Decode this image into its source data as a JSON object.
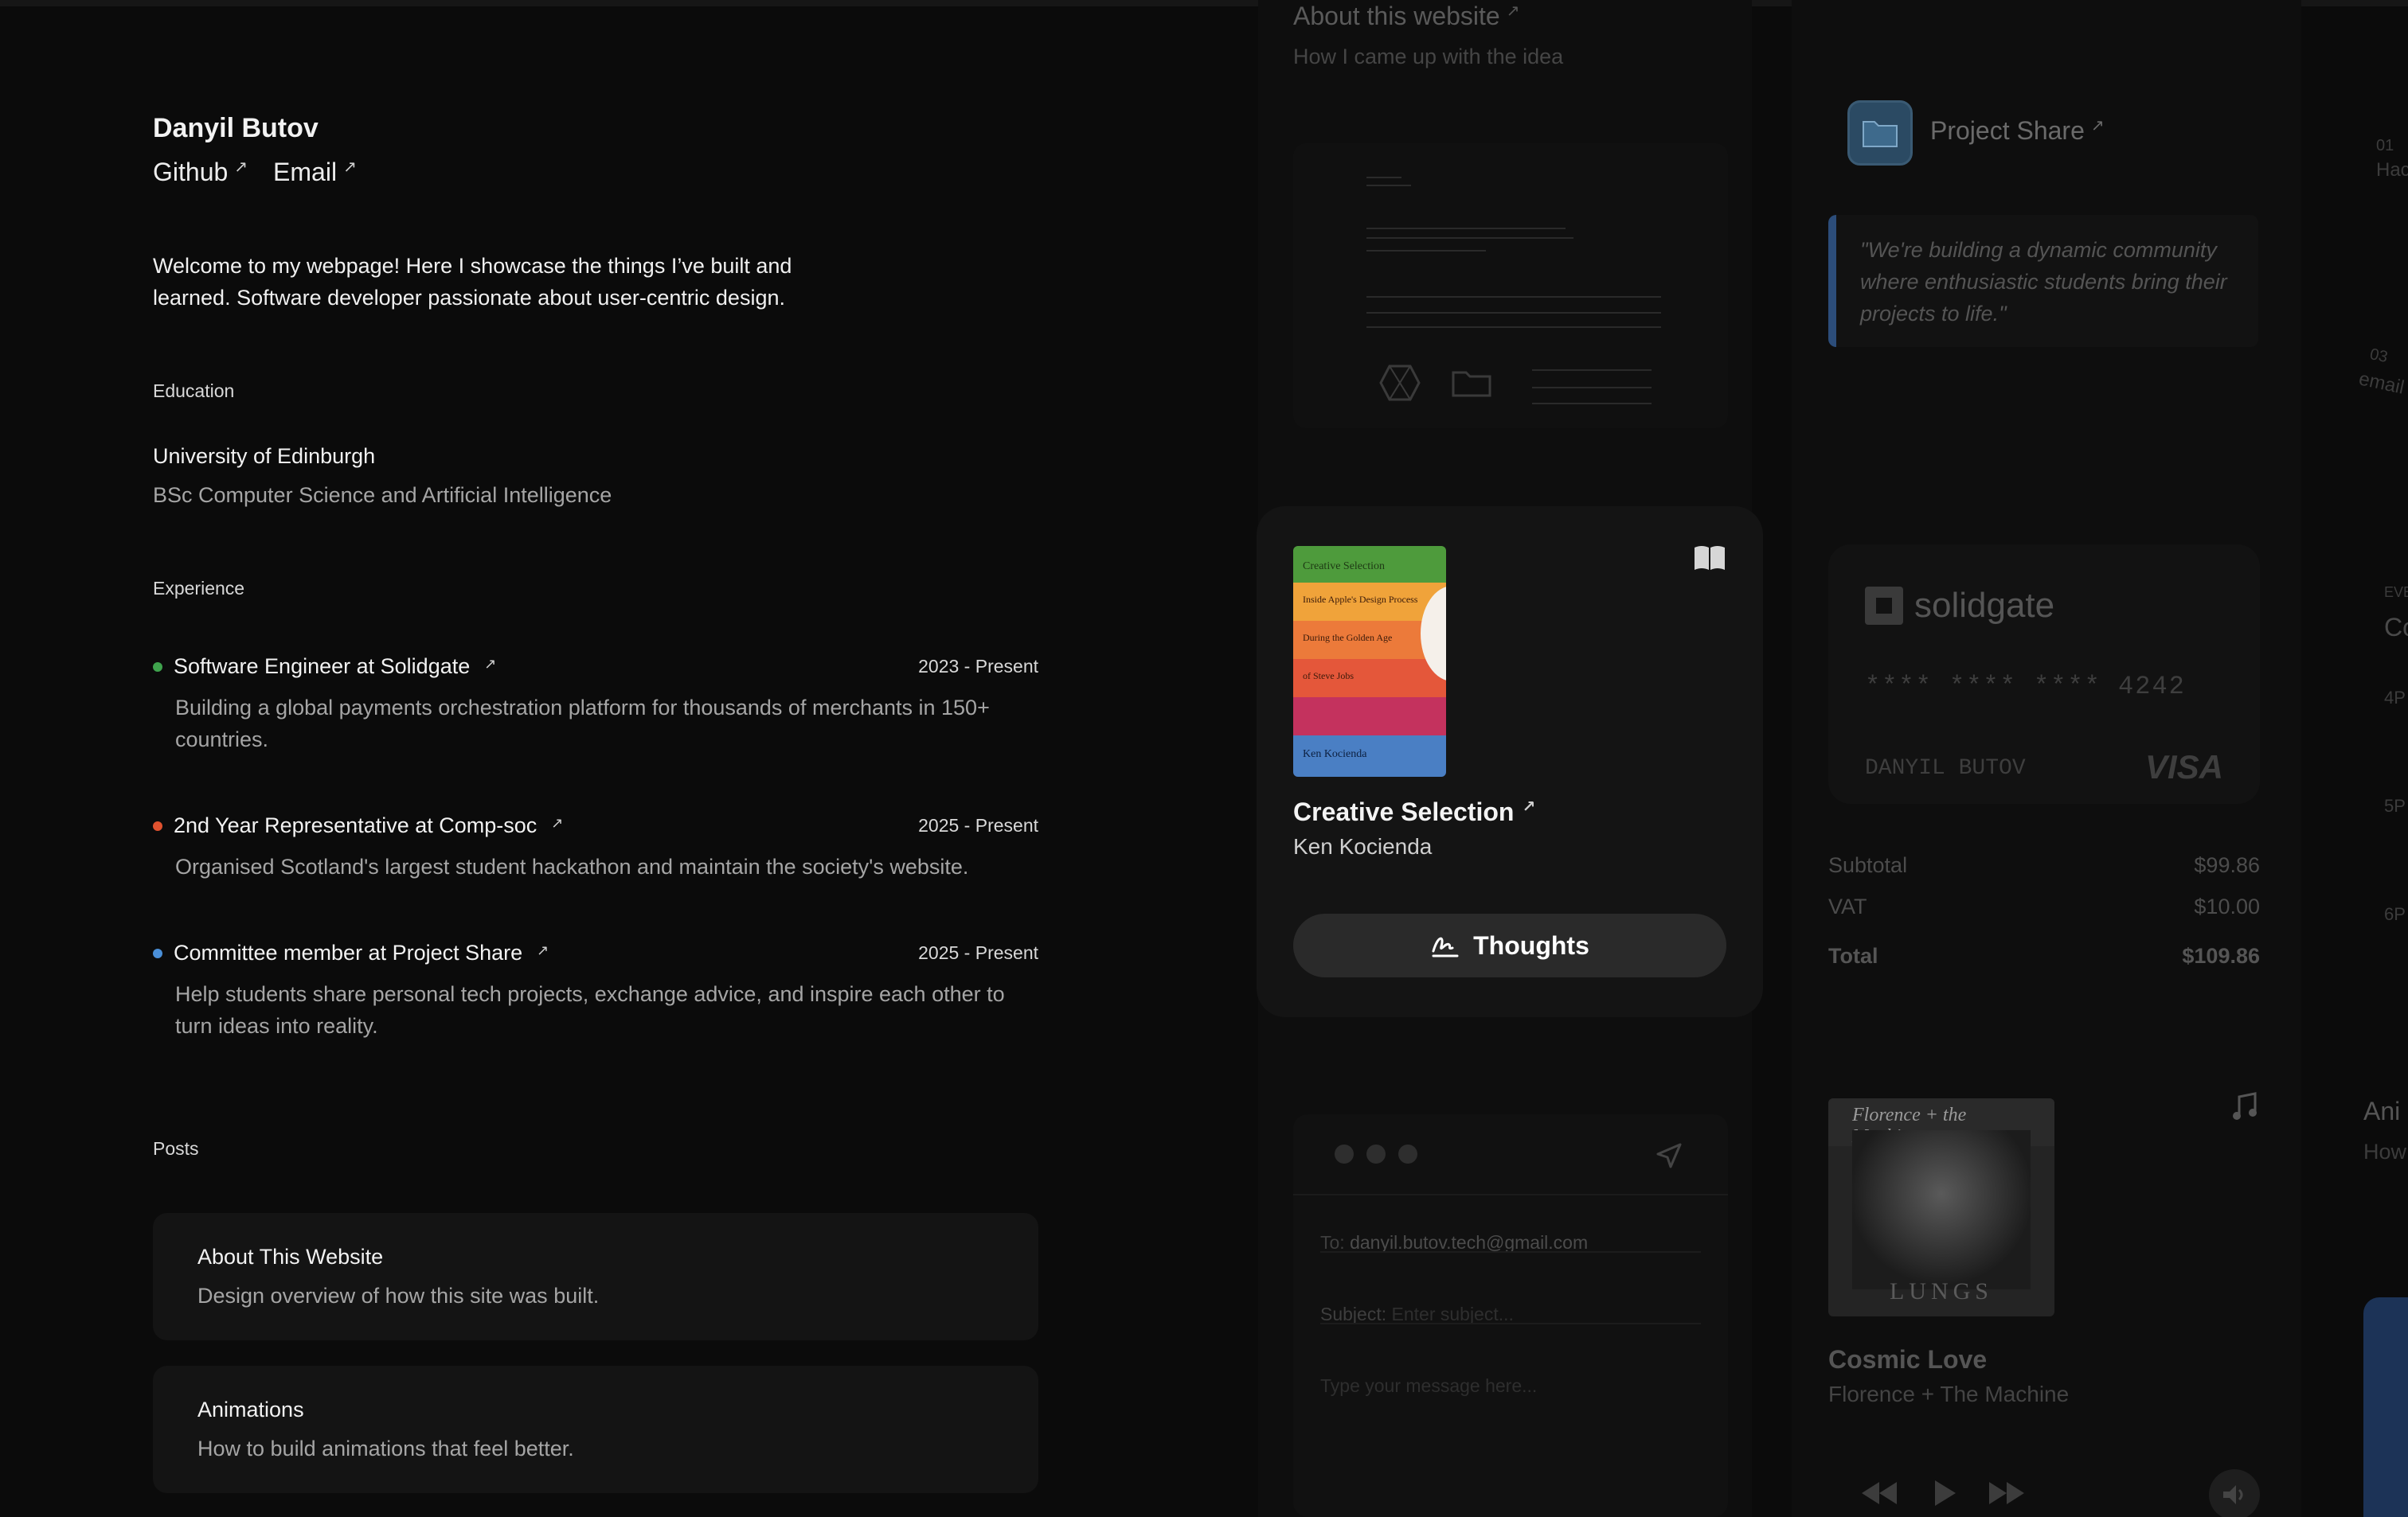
{
  "profile": {
    "name": "Danyil Butov",
    "links": [
      {
        "label": "Github"
      },
      {
        "label": "Email"
      }
    ],
    "intro": "Welcome to my webpage! Here I showcase the things I’ve built and learned. Software developer passionate about user-centric design."
  },
  "education": {
    "label": "Education",
    "school": "University of Edinburgh",
    "degree": "BSc Computer Science and Artificial Intelligence"
  },
  "experience": {
    "label": "Experience",
    "items": [
      {
        "title": "Software Engineer at Solidgate",
        "dates": "2023 - Present",
        "dot_color": "#3fa34d",
        "description": "Building a global payments orchestration platform for thousands of merchants in 150+ countries."
      },
      {
        "title": "2nd Year Representative at Comp-soc",
        "dates": "2025 - Present",
        "dot_color": "#e0522f",
        "description": "Organised Scotland's largest student hackathon and maintain the society's website."
      },
      {
        "title": "Committee member at Project Share",
        "dates": "2025 - Present",
        "dot_color": "#4a8fd8",
        "description": "Help students share personal tech projects, exchange advice, and inspire each other to turn ideas into reality."
      }
    ]
  },
  "posts": {
    "label": "Posts",
    "items": [
      {
        "title": "About This Website",
        "description": "Design overview of how this site was built."
      },
      {
        "title": "Animations",
        "description": "How to build animations that feel better."
      }
    ]
  },
  "showcase": {
    "about": {
      "title": "About this website",
      "subtitle": "How I came up with the idea"
    },
    "project_share": {
      "title": "Project Share",
      "quote": "\"We're building a dynamic community where enthusiastic students bring their projects to life.\""
    },
    "book": {
      "title": "Creative Selection",
      "author": "Ken Kocienda",
      "cover_lines": [
        "Creative Selection",
        "Inside Apple's Design Process",
        "During the Golden Age",
        "of Steve Jobs",
        "Ken Kocienda"
      ],
      "button_label": "Thoughts",
      "icon": "open-book-icon"
    },
    "payment": {
      "brand": "solidgate",
      "card_number": "**** **** **** 4242",
      "card_holder": "DANYIL BUTOV",
      "network": "VISA",
      "lines": [
        {
          "label": "Subtotal",
          "amount": "$99.86"
        },
        {
          "label": "VAT",
          "amount": "$10.00"
        },
        {
          "label": "Total",
          "amount": "$109.86"
        }
      ]
    },
    "mail": {
      "to_label": "To:",
      "to_value": "danyil.butov.tech@gmail.com",
      "subject_label": "Subject:",
      "subject_placeholder": "Enter subject...",
      "message_placeholder": "Type your message here..."
    },
    "music": {
      "cover_text": "Florence + the Machine",
      "album_text": "LUNGS",
      "song": "Cosmic Love",
      "artist": "Florence + The Machine"
    },
    "edge": {
      "hack_index": "01",
      "hack_text": "Hac",
      "email_index": "03",
      "email_text": "email",
      "eve_text": "EVE",
      "co_text": "Co",
      "times": [
        "4P",
        "5P",
        "6P"
      ],
      "ani_title": "Ani",
      "ani_sub": "How"
    }
  }
}
